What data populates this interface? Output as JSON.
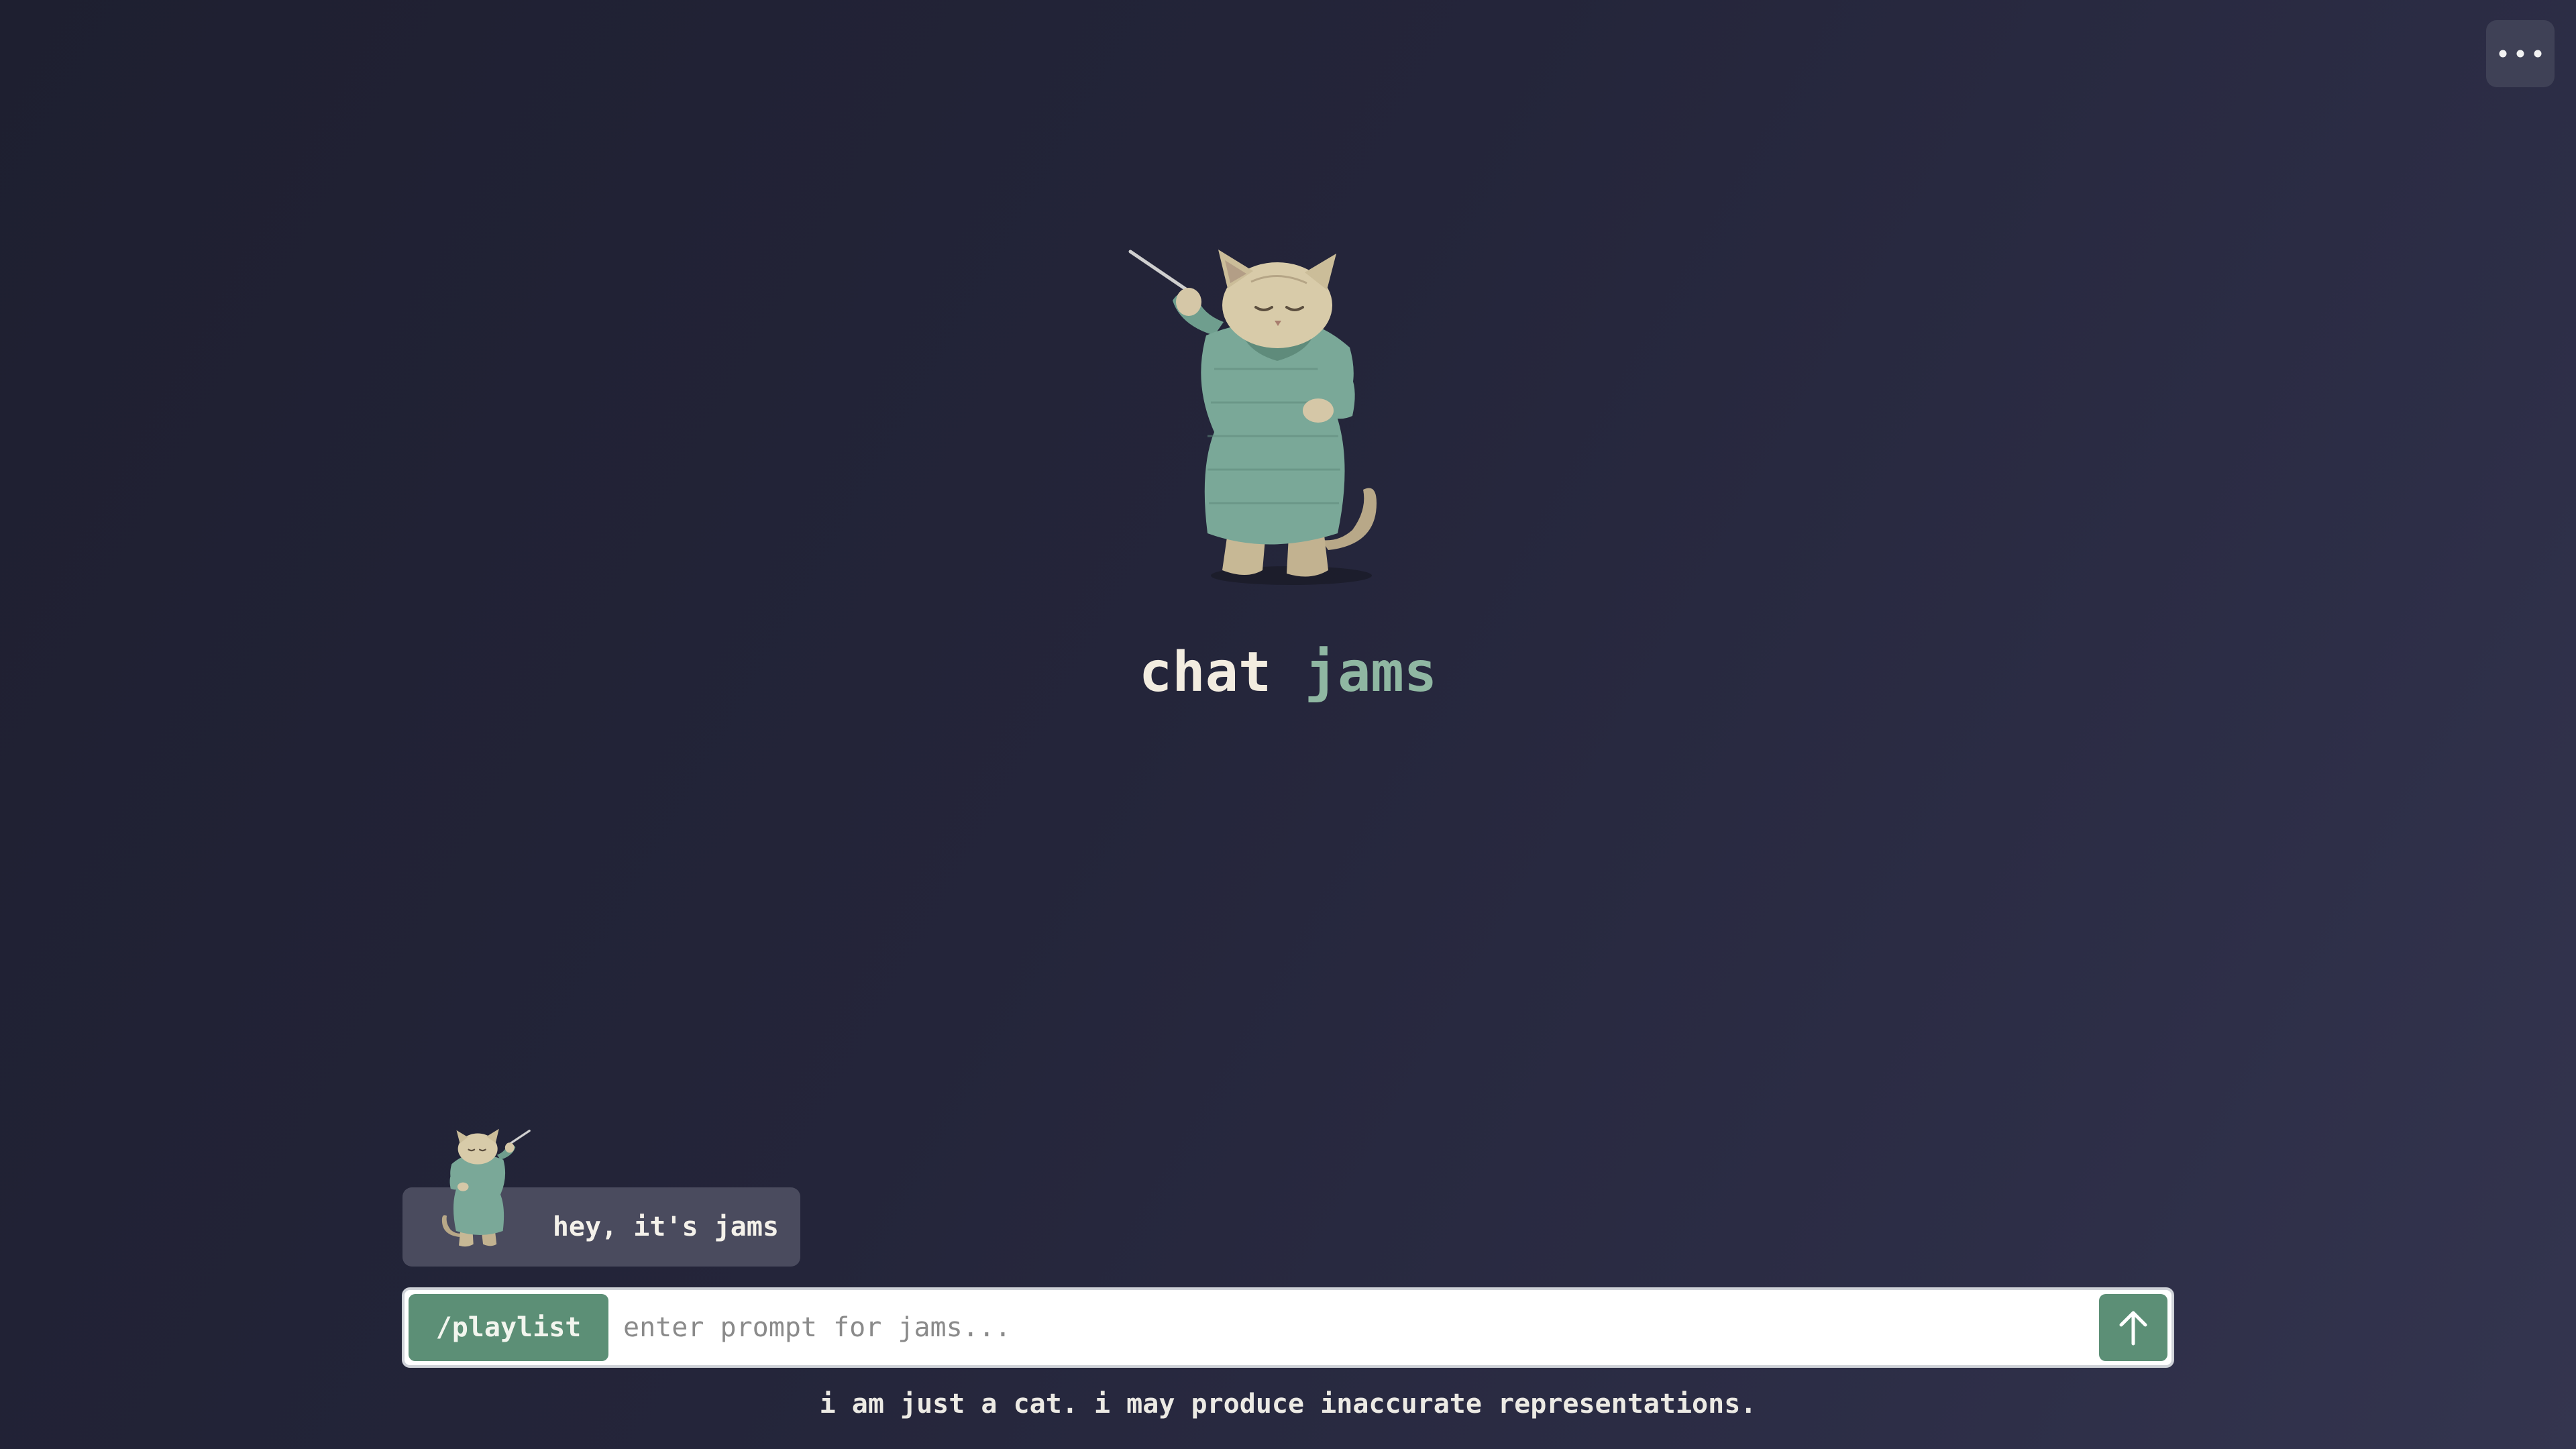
{
  "header": {
    "menu_icon": "ellipsis-icon"
  },
  "hero": {
    "mascot_icon": "conductor-cat-illustration",
    "title_primary": "chat",
    "title_accent": "jams"
  },
  "chat": {
    "greeting": "hey, it's jams",
    "avatar_icon": "conductor-cat-avatar"
  },
  "composer": {
    "command_label": "/playlist",
    "input_value": "",
    "input_placeholder": "enter prompt for jams...",
    "send_icon": "arrow-up-icon"
  },
  "footer": {
    "disclaimer": "i am just a cat. i may produce inaccurate representations."
  },
  "colors": {
    "accent_green": "#5c8f76",
    "title_accent": "#8fb7a2",
    "background": "#24253a"
  }
}
